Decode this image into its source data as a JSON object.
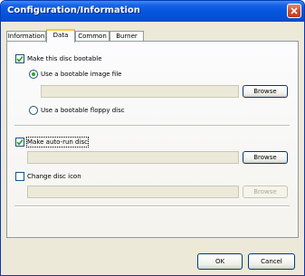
{
  "window": {
    "title": "Configuration/Information"
  },
  "tabs": [
    {
      "label": "Information"
    },
    {
      "label": "Data"
    },
    {
      "label": "Common"
    },
    {
      "label": "Burner"
    }
  ],
  "bootable": {
    "label": "Make this disc bootable",
    "checked": true,
    "option_image_label": "Use a bootable image file",
    "option_floppy_label": "Use a bootable floppy disc",
    "image_path_value": "",
    "browse_label": "Browse"
  },
  "autorun": {
    "label": "Make auto-run disc",
    "checked": true,
    "path_value": "",
    "browse_label": "Browse"
  },
  "icon": {
    "label": "Change disc icon",
    "checked": false,
    "path_value": "",
    "browse_label": "Browse"
  },
  "footer": {
    "ok_label": "OK",
    "cancel_label": "Cancel"
  },
  "colors": {
    "titlebar": "#0758e0",
    "dialog_bg": "#ece9d8",
    "active_tab_accent": "#ffc83c",
    "checkmark": "#21a121",
    "radio_dot": "#2aa52a"
  }
}
